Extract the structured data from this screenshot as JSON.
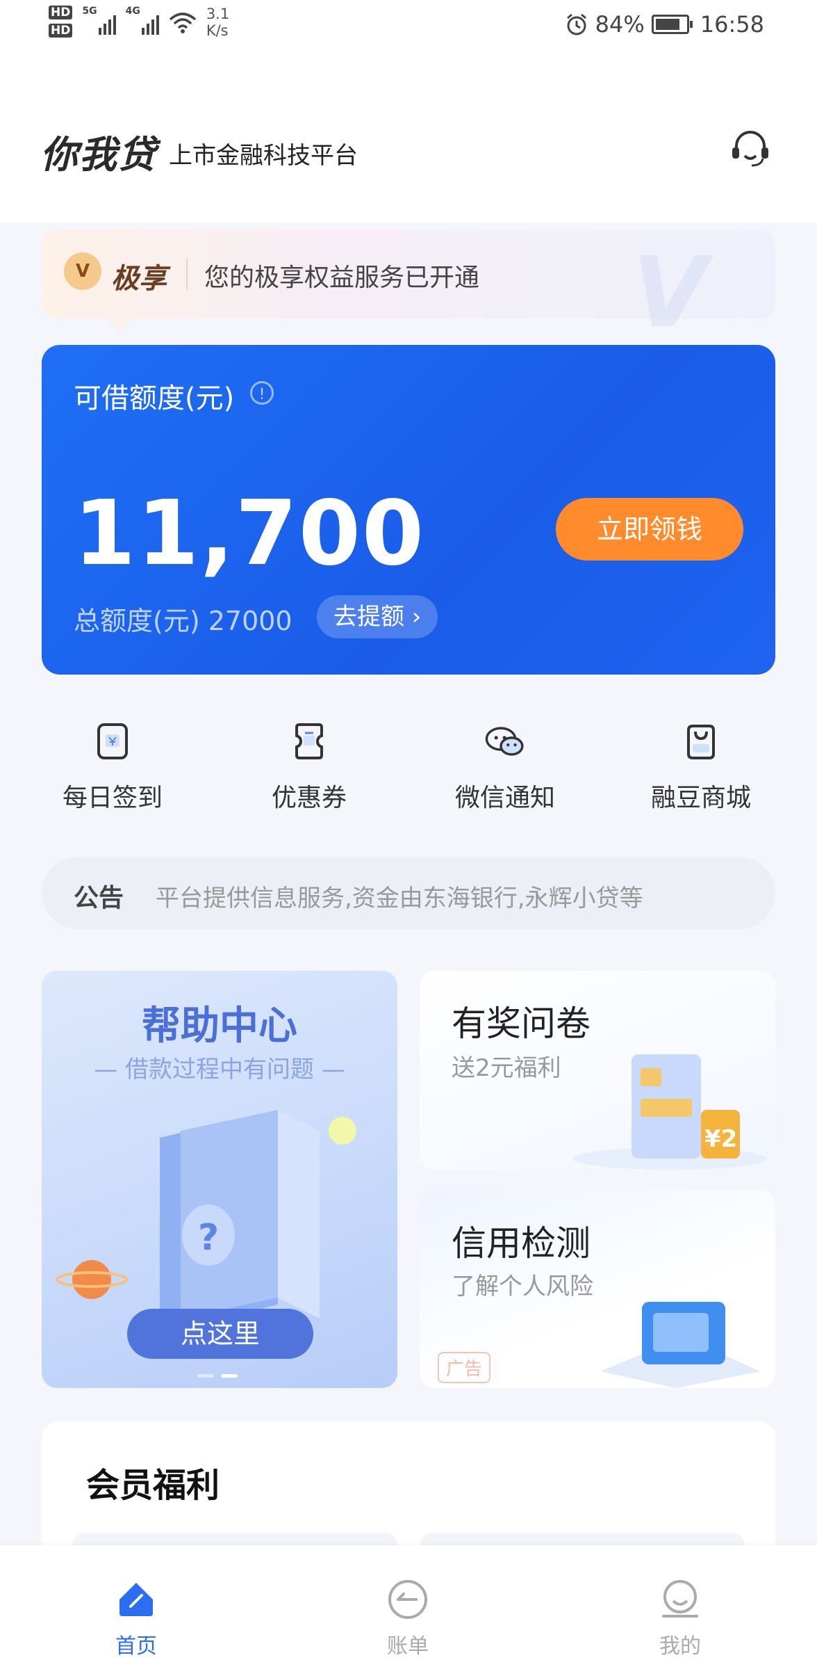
{
  "status_bar": {
    "hd1": "HD",
    "hd2": "HD",
    "net1": "5G",
    "net2": "4G",
    "speed_value": "3.1",
    "speed_unit": "K/s",
    "battery": "84%",
    "time": "16:58"
  },
  "header": {
    "brand": "你我贷",
    "tagline": "上市金融科技平台"
  },
  "vip": {
    "badge": "V",
    "name": "极享",
    "text": "您的极享权益服务已开通",
    "watermark": "V"
  },
  "credit": {
    "label": "可借额度(元)",
    "info": "!",
    "amount": "11,700",
    "cta": "立即领钱",
    "total": "总额度(元) 27000",
    "raise": "去提额 ›"
  },
  "quick_actions": [
    {
      "label": "每日签到",
      "icon": "calendar-check-icon"
    },
    {
      "label": "优惠券",
      "icon": "coupon-icon"
    },
    {
      "label": "微信通知",
      "icon": "wechat-icon"
    },
    {
      "label": "融豆商城",
      "icon": "shopping-bag-icon"
    }
  ],
  "notice": {
    "title": "公告",
    "text": "平台提供信息服务,资金由东海银行,永辉小贷等"
  },
  "promo": {
    "help_title": "帮助中心",
    "help_sub": "— 借款过程中有问题 —",
    "help_btn": "点这里",
    "help_icon": "?",
    "survey_title": "有奖问卷",
    "survey_sub": "送2元福利",
    "survey_coin": "¥2",
    "credit_title": "信用检测",
    "credit_sub": "了解个人风险",
    "ad_tag": "广告"
  },
  "member": {
    "title": "会员福利"
  },
  "tabs": [
    {
      "label": "首页",
      "active": true
    },
    {
      "label": "账单",
      "active": false
    },
    {
      "label": "我的",
      "active": false
    }
  ],
  "colors": {
    "primary": "#1f6ff5",
    "accent": "#ff8b2c",
    "tab_active": "#2b6ef2"
  }
}
